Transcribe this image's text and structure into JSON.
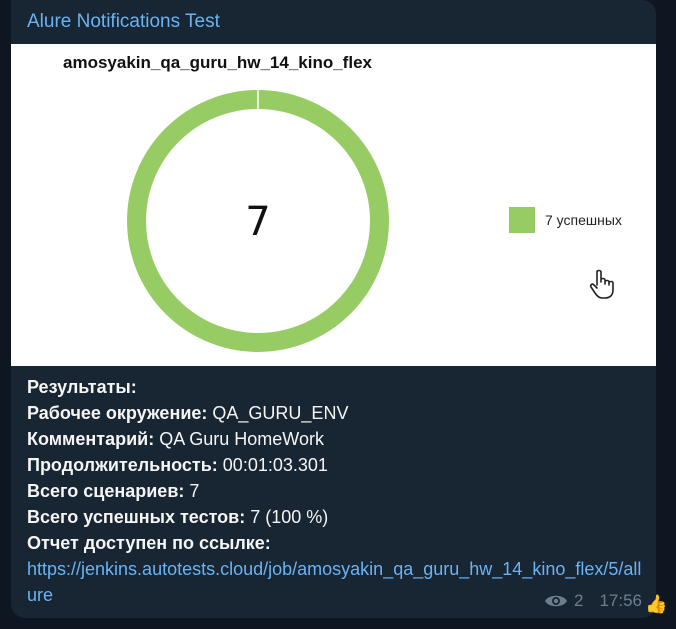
{
  "message": {
    "channel_name": "Alure Notifications Test",
    "results_title": "Результаты:",
    "env_label": "Рабочее окружение:",
    "env_value": "QA_GURU_ENV",
    "comment_label": "Комментарий:",
    "comment_value": "QA Guru HomeWork",
    "duration_label": "Продолжительность:",
    "duration_value": "00:01:03.301",
    "scenarios_label": "Всего сценариев:",
    "scenarios_value": "7",
    "passed_label": "Всего успешных тестов:",
    "passed_value": "7 (100 %)",
    "report_label": "Отчет доступен по ссылке:",
    "report_link": "https://jenkins.autotests.cloud/job/amosyakin_qa_guru_hw_14_kino_flex/5/allure",
    "views": "2",
    "time": "17:56",
    "reaction_icon": "thumbs-up-icon"
  },
  "chart_data": {
    "type": "pie",
    "title": "amosyakin_qa_guru_hw_14_kino_flex",
    "center_label": "7",
    "slices": [
      {
        "label": "7 успешных",
        "value": 7,
        "color": "#97cc64"
      }
    ]
  }
}
